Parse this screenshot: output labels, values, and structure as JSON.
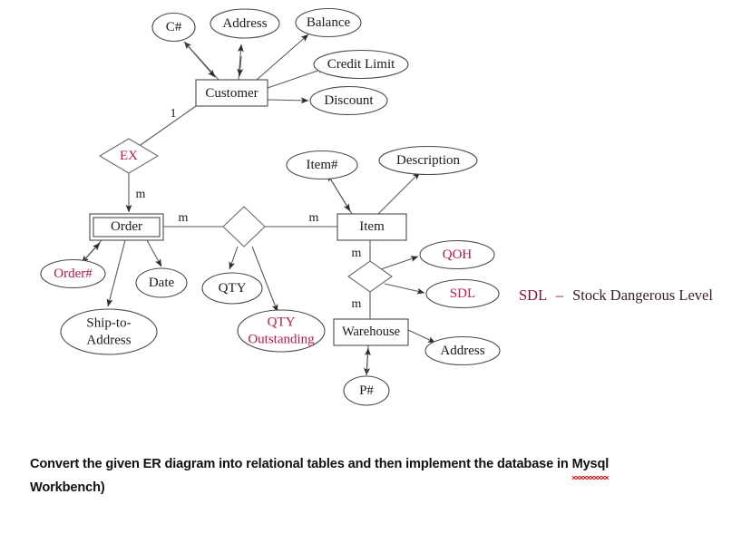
{
  "diagram": {
    "title": "ER Diagram",
    "colors": {
      "red": "#b81a42",
      "legend_red": "#8a1530",
      "stroke": "#4a4a4a",
      "text": "#1a1a1a",
      "background": "#ffffff",
      "spellcheck_underline": "#e01b1b"
    },
    "entities": [
      {
        "id": "customer",
        "label": "Customer",
        "weak": false
      },
      {
        "id": "order",
        "label": "Order",
        "weak": true
      },
      {
        "id": "item",
        "label": "Item",
        "weak": false
      },
      {
        "id": "warehouse",
        "label": "Warehouse",
        "weak": false
      }
    ],
    "relationships": [
      {
        "id": "ex",
        "label": "EX",
        "red": true
      },
      {
        "id": "rel-mid",
        "label": "",
        "red": false
      },
      {
        "id": "rel-low",
        "label": "",
        "red": false
      }
    ],
    "attributes": [
      {
        "id": "c-num",
        "label": "C#",
        "red": false,
        "owner": "customer"
      },
      {
        "id": "c-address",
        "label": "Address",
        "red": false,
        "owner": "customer"
      },
      {
        "id": "c-balance",
        "label": "Balance",
        "red": false,
        "owner": "customer"
      },
      {
        "id": "c-credit",
        "label": "Credit Limit",
        "red": false,
        "owner": "customer"
      },
      {
        "id": "c-discount",
        "label": "Discount",
        "red": false,
        "owner": "customer"
      },
      {
        "id": "o-num",
        "label": "Order#",
        "red": true,
        "owner": "order"
      },
      {
        "id": "o-date",
        "label": "Date",
        "red": false,
        "owner": "order"
      },
      {
        "id": "o-shipto",
        "label": "Ship-to-",
        "label2": "Address",
        "red": false,
        "owner": "order"
      },
      {
        "id": "r-qty",
        "label": "QTY",
        "red": false,
        "owner": "rel-mid"
      },
      {
        "id": "r-qtyout",
        "label": "QTY",
        "label2": "Outstanding",
        "red": true,
        "owner": "rel-mid"
      },
      {
        "id": "i-num",
        "label": "Item#",
        "red": false,
        "owner": "item"
      },
      {
        "id": "i-desc",
        "label": "Description",
        "red": false,
        "owner": "item"
      },
      {
        "id": "r-qoh",
        "label": "QOH",
        "red": true,
        "owner": "rel-low"
      },
      {
        "id": "r-sdl",
        "label": "SDL",
        "red": true,
        "owner": "rel-low"
      },
      {
        "id": "w-address",
        "label": "Address",
        "red": false,
        "owner": "warehouse"
      },
      {
        "id": "w-pnum",
        "label": "P#",
        "red": false,
        "owner": "warehouse"
      }
    ],
    "cardinalities": [
      {
        "id": "card-1",
        "label": "1"
      },
      {
        "id": "card-m-order",
        "label": "m"
      },
      {
        "id": "card-m-left",
        "label": "m"
      },
      {
        "id": "card-m-right",
        "label": "m"
      },
      {
        "id": "card-m-item",
        "label": "m"
      },
      {
        "id": "card-m-wh",
        "label": "m"
      }
    ],
    "legend": {
      "abbreviation": "SDL",
      "dash": "–",
      "expansion": "Stock Dangerous Level",
      "full": "SDL – Stock Dangerous Level"
    }
  },
  "caption": {
    "line1_before": "Convert the given ER diagram into relational tables  and then implement the database in ",
    "line1_misspelled": "Mysql",
    "line2": "Workbench)"
  }
}
